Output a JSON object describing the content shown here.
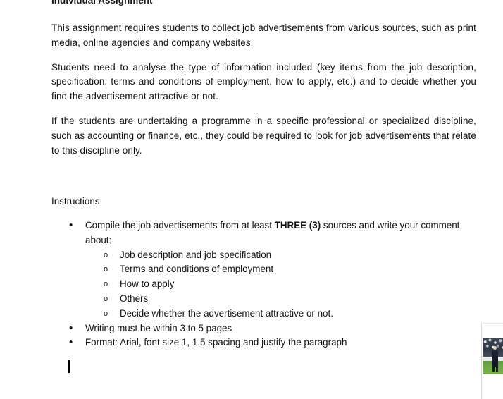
{
  "document": {
    "cutoff_heading": "Individual Assignment",
    "paragraphs": [
      "This assignment requires students to collect job advertisements from various sources, such as print media, online agencies and company websites.",
      "Students need to analyse the type of information included (key items from the job description, specification, terms and conditions of employment, how to apply, etc.) and to decide whether you find the advertisement attractive or not.",
      "If the students are undertaking a programme in a specific professional or specialized discipline, such as accounting or finance, etc., they could be required to look for job advertisements that relate to this discipline only."
    ],
    "instructions_label": "Instructions:",
    "bullets": [
      {
        "marker": "•",
        "text_before_bold": "Compile the job advertisements from at least ",
        "bold": "THREE (3)",
        "text_after_bold": " sources and write your comment",
        "continuation": "about:"
      },
      {
        "marker": "•",
        "text": "Writing must be within 3 to 5 pages"
      },
      {
        "marker": "•",
        "text": "Format: Arial, font size 1, 1.5 spacing and justify the paragraph"
      }
    ],
    "sub_bullets": {
      "marker": "o",
      "items": [
        "Job description and job specification",
        "Terms and conditions of employment",
        "How to apply",
        "Others",
        "Decide whether the advertisement attractive or not."
      ]
    }
  },
  "image_panel": {
    "caption": "football-pitch-photo",
    "colors": {
      "crowd": "#2f3744",
      "hoarding": "#e3e7ea",
      "pitch": "#6da645",
      "figure": "#141a24"
    }
  },
  "colors": {
    "page_background": "#ffffff",
    "text": "#111111",
    "caret": "#000000"
  }
}
